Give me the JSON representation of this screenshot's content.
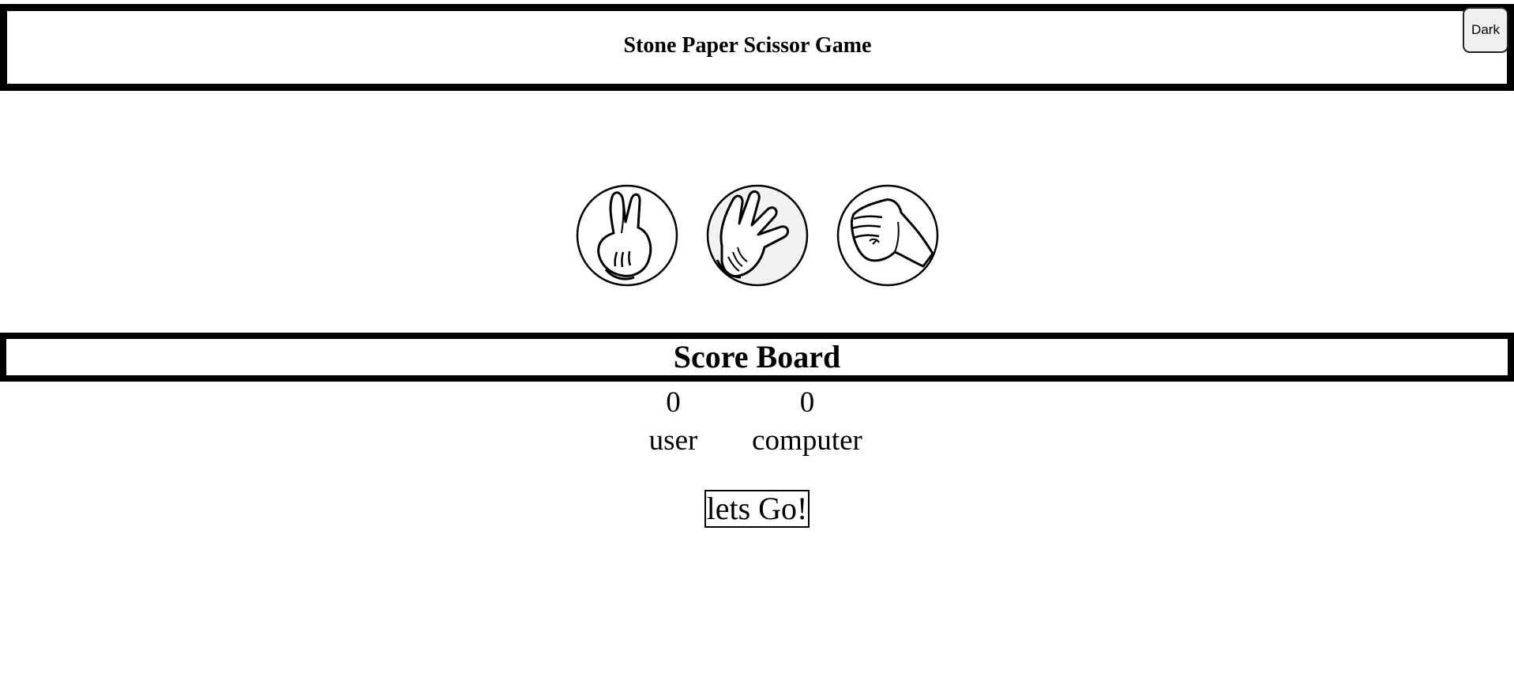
{
  "header": {
    "title": "Stone Paper Scissor Game"
  },
  "theme_toggle": {
    "label": "Dark"
  },
  "choices": [
    {
      "id": "scissor",
      "icon": "scissor-hand-icon"
    },
    {
      "id": "paper",
      "icon": "paper-hand-icon"
    },
    {
      "id": "stone",
      "icon": "stone-fist-icon"
    }
  ],
  "scoreboard": {
    "title": "Score Board",
    "user": {
      "score": "0",
      "label": "user"
    },
    "computer": {
      "score": "0",
      "label": "computer"
    }
  },
  "message": {
    "label": "lets Go!"
  }
}
